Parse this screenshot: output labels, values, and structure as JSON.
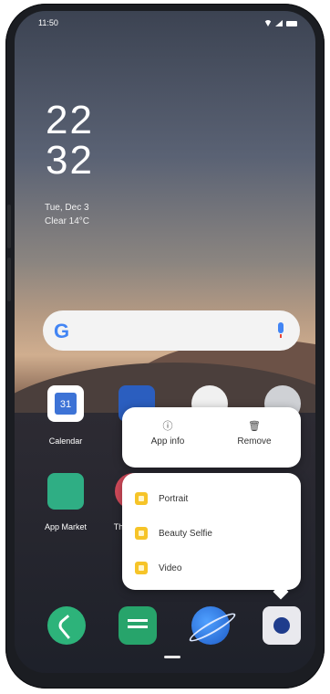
{
  "status_bar": {
    "time": "11:50"
  },
  "clock": {
    "hour": "22",
    "minute": "32",
    "date": "Tue, Dec 3",
    "weather": "Clear 14°C"
  },
  "search_bar": {
    "logo": "G"
  },
  "apps": [
    {
      "label": "Calendar",
      "icon": "calendar-icon",
      "badge": "31"
    },
    {
      "label": "",
      "icon": "gallery-icon"
    },
    {
      "label": "",
      "icon": "clock-icon"
    },
    {
      "label": "",
      "icon": "settings-icon"
    },
    {
      "label": "App Market",
      "icon": "app-market-icon"
    },
    {
      "label": "Th",
      "icon": "themes-icon"
    }
  ],
  "context_menu": {
    "app_info": "App info",
    "remove": "Remove"
  },
  "shortcuts": [
    {
      "label": "Portrait"
    },
    {
      "label": "Beauty Selfie"
    },
    {
      "label": "Video"
    }
  ],
  "dock": [
    {
      "icon": "phone-icon",
      "color": "#2db37a"
    },
    {
      "icon": "messages-icon",
      "color": "#27a46b"
    },
    {
      "icon": "browser-icon",
      "color": "#2f7de1"
    },
    {
      "icon": "camera-icon",
      "color": "#e9e9ee"
    }
  ]
}
